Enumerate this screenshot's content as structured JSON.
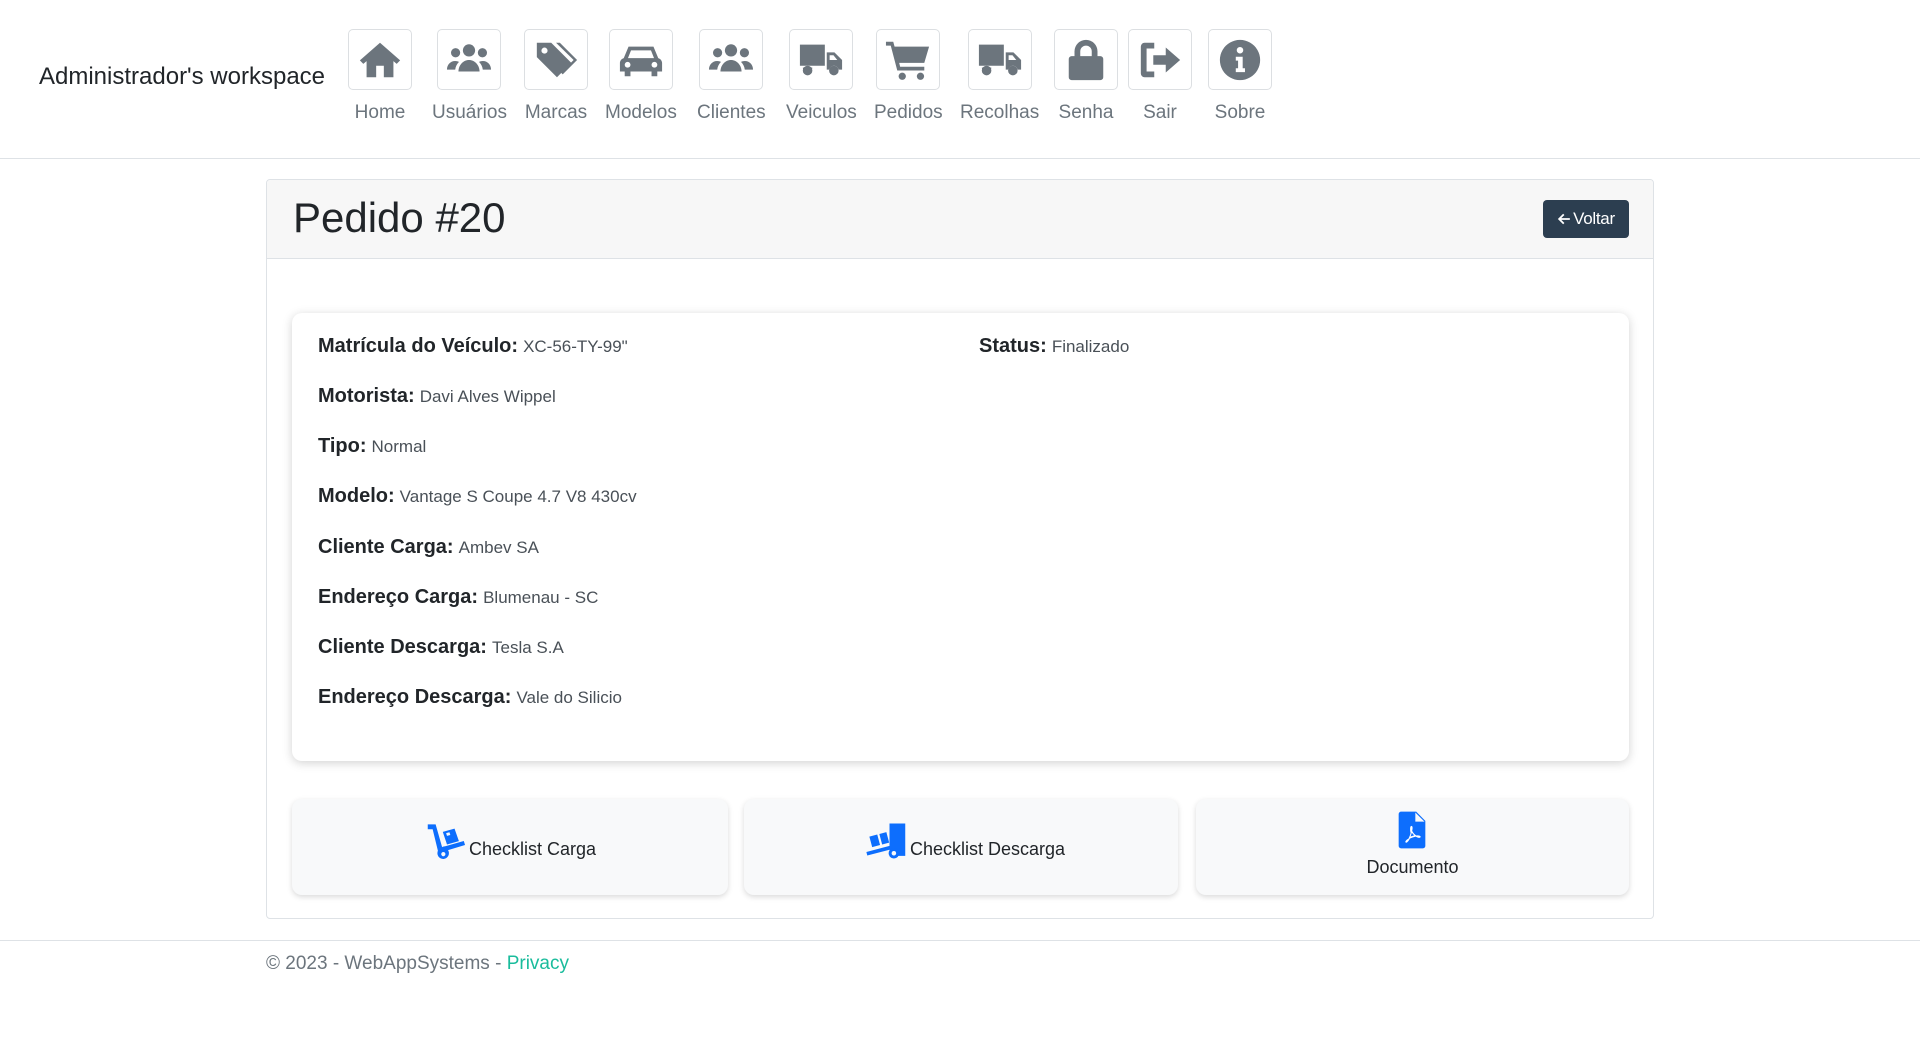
{
  "navbar": {
    "brand": "Administrador's workspace",
    "items": [
      {
        "label": "Home",
        "icon": "home-icon"
      },
      {
        "label": "Usuários",
        "icon": "users-icon"
      },
      {
        "label": "Marcas",
        "icon": "tags-icon"
      },
      {
        "label": "Modelos",
        "icon": "car-icon"
      },
      {
        "label": "Clientes",
        "icon": "users-icon"
      },
      {
        "label": "Veiculos",
        "icon": "truck-icon"
      },
      {
        "label": "Pedidos",
        "icon": "cart-icon"
      },
      {
        "label": "Recolhas",
        "icon": "truck-icon"
      },
      {
        "label": "Senha",
        "icon": "lock-icon"
      },
      {
        "label": "Sair",
        "icon": "sign-out-icon"
      },
      {
        "label": "Sobre",
        "icon": "info-circle-icon"
      }
    ]
  },
  "card": {
    "title": "Pedido #20",
    "back_button": "Voltar"
  },
  "details": {
    "matricula": {
      "label": "Matrícula do Veículo:",
      "value": "XC-56-TY-99\""
    },
    "motorista": {
      "label": "Motorista:",
      "value": "Davi Alves Wippel"
    },
    "tipo": {
      "label": "Tipo:",
      "value": "Normal"
    },
    "modelo": {
      "label": "Modelo:",
      "value": "Vantage S Coupe 4.7 V8 430cv"
    },
    "cliente_carga": {
      "label": "Cliente Carga:",
      "value": "Ambev SA"
    },
    "endereco_carga": {
      "label": "Endereço Carga:",
      "value": "Blumenau - SC"
    },
    "cliente_descarga": {
      "label": "Cliente Descarga:",
      "value": "Tesla S.A"
    },
    "endereco_descarga": {
      "label": "Endereço Descarga:",
      "value": "Vale do Silicio"
    },
    "status": {
      "label": "Status:",
      "value": "Finalizado"
    }
  },
  "actions": {
    "checklist_carga": "Checklist Carga",
    "checklist_descarga": "Checklist Descarga",
    "documento": "Documento"
  },
  "footer": {
    "copyright": "© 2023 - WebAppSystems - ",
    "privacy": "Privacy"
  },
  "colors": {
    "accent": "#0d6efd",
    "back_button": "#2c3e50",
    "link": "#1abc9c",
    "icon_gray": "#6c757d"
  }
}
